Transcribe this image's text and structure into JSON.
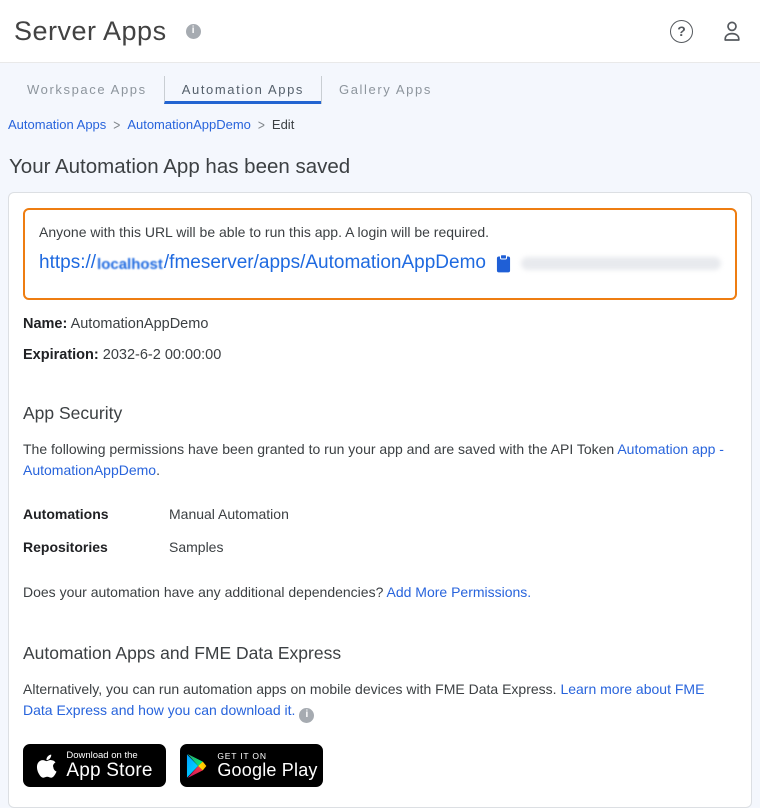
{
  "header": {
    "title": "Server Apps",
    "help_label": "?",
    "info_glyph": "i"
  },
  "tabs": [
    {
      "label": "Workspace Apps",
      "active": false
    },
    {
      "label": "Automation Apps",
      "active": true
    },
    {
      "label": "Gallery Apps",
      "active": false
    }
  ],
  "breadcrumb": {
    "separator": ">",
    "items": [
      "Automation Apps",
      "AutomationAppDemo",
      "Edit"
    ]
  },
  "page_title": "Your Automation App has been saved",
  "url_box": {
    "note": "Anyone with this URL will be able to run this app. A login will be required.",
    "url_scheme": "https://",
    "url_host": "localhost",
    "url_path": "/fmeserver/apps/AutomationAppDemo"
  },
  "details": {
    "name_label": "Name:",
    "name_value": "AutomationAppDemo",
    "expiration_label": "Expiration:",
    "expiration_value": "2032-6-2 00:00:00"
  },
  "security": {
    "heading": "App Security",
    "description": "The following permissions have been granted to run your app and are saved with the API Token ",
    "token_link": "Automation app - AutomationAppDemo",
    "description_end": ".",
    "permissions": [
      {
        "label": "Automations",
        "value": "Manual Automation"
      },
      {
        "label": "Repositories",
        "value": "Samples"
      }
    ],
    "dependencies_text": "Does your automation have any additional dependencies? ",
    "dependencies_link": "Add More Permissions."
  },
  "express": {
    "heading": "Automation Apps and FME Data Express",
    "text": "Alternatively, you can run automation apps on mobile devices with FME Data Express. ",
    "link": "Learn more about FME Data Express and how you can download it.",
    "info_glyph": "i"
  },
  "badges": {
    "app_store": {
      "line1": "Download on the",
      "line2": "App Store"
    },
    "google_play": {
      "line1": "GET IT ON",
      "line2": "Google Play"
    }
  },
  "colors": {
    "accent_orange": "#ee7d11",
    "link_blue": "#2864dc",
    "url_blue": "#1f6ae0",
    "tab_underline": "#2264d1",
    "badge_black": "#000000"
  }
}
